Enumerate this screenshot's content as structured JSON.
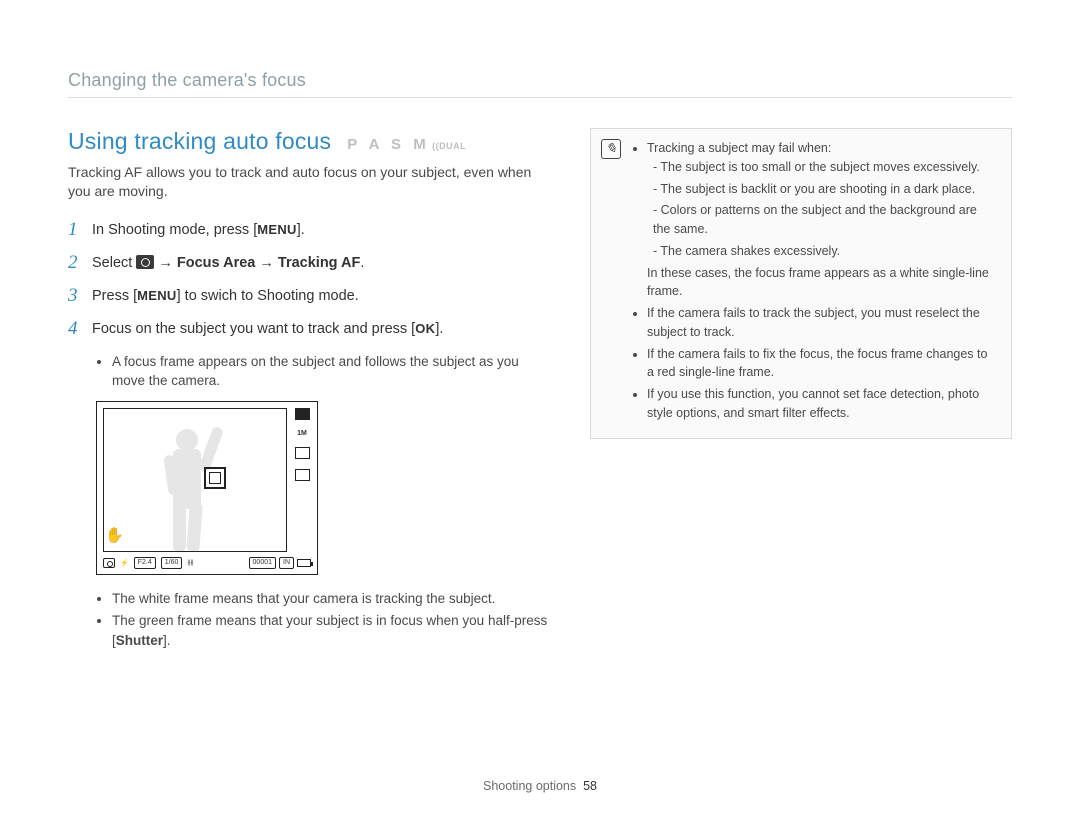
{
  "breadcrumb": "Changing the camera's focus",
  "heading": "Using tracking auto focus",
  "modes": "P A S M",
  "mode_dual": "DUAL",
  "intro": "Tracking AF allows you to track and auto focus on your subject, even when you are moving.",
  "steps": {
    "s1_a": "In Shooting mode, press [",
    "s1_b": "].",
    "s2_a": "Select ",
    "s2_b": " → ",
    "s2_c": "Focus Area",
    "s2_d": " → ",
    "s2_e": "Tracking AF",
    "s2_f": ".",
    "s3_a": "Press [",
    "s3_b": "] to swich to Shooting mode.",
    "s4_a": "Focus on the subject you want to track and press [",
    "s4_b": "].",
    "s4_sub": "A focus frame appears on the subject and follows the subject as you move the camera.",
    "post1": "The white frame means that your camera is tracking the subject.",
    "post2_a": "The green frame means that your subject is in focus when you half-press [",
    "post2_b": "].",
    "shutter": "Shutter"
  },
  "icons": {
    "menu": "MENU",
    "ok": "OK"
  },
  "illus": {
    "side_text": "1M",
    "f": "F2.4",
    "sh": "1/60",
    "count": "00001",
    "in": "IN"
  },
  "note": {
    "lead": "Tracking a subject may fail when:",
    "d1": "The subject is too small or the subject moves excessively.",
    "d2": "The subject is backlit or you are shooting in a dark place.",
    "d3": "Colors or patterns on the subject and the background are the same.",
    "d4": "The camera shakes excessively.",
    "after": "In these cases, the focus frame appears as a white single-line frame.",
    "b2": "If the camera fails to track the subject, you must reselect the subject to track.",
    "b3": "If the camera fails to fix the focus, the focus frame changes to a red single-line frame.",
    "b4": "If you use this function, you cannot set face detection, photo style options, and smart filter effects."
  },
  "footer": {
    "section": "Shooting options",
    "page": "58"
  }
}
